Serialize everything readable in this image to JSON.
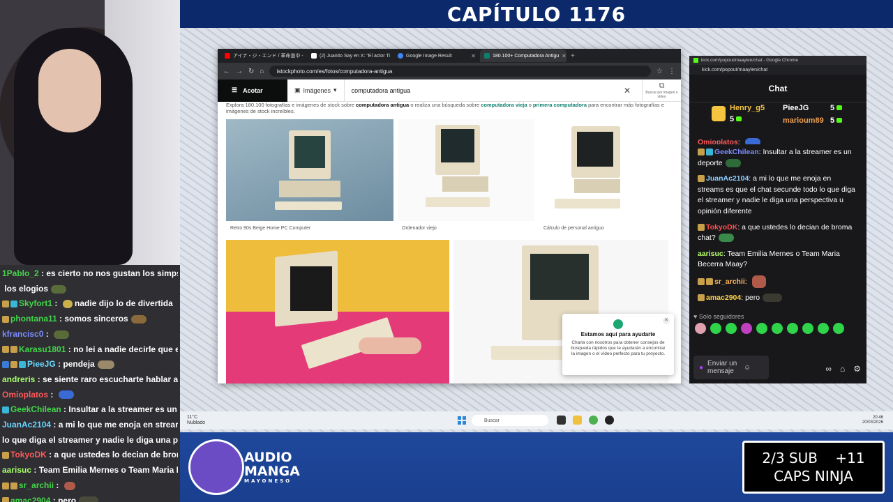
{
  "stream": {
    "chapter_title": "CAPÍTULO 1176",
    "logo_line1": "AUDIO",
    "logo_line2": "MANGA",
    "logo_line3": "MAYONESO",
    "sub_goal": "2/3 SUB    +11",
    "sub_name": "CAPS NINJA"
  },
  "left_chat": [
    {
      "user": "1Pablo_2",
      "text": "es cierto no nos gustan los simps, p",
      "color": "green"
    },
    {
      "user": "",
      "text": "los elogios",
      "color": "white"
    },
    {
      "user": "Skyfort1",
      "text": "nadie dijo lo de divertida",
      "color": "green"
    },
    {
      "user": "phontana11",
      "text": "somos sinceros",
      "color": "green"
    },
    {
      "user": "kfrancisc0",
      "text": "",
      "color": "blue"
    },
    {
      "user": "Karasu1801",
      "text": "no lei a nadie decirle que era",
      "color": "green"
    },
    {
      "user": "PieeJG",
      "text": "pendeja",
      "color": "white"
    },
    {
      "user": "andreris",
      "text": "se siente raro escucharte hablar arge",
      "color": "lime"
    },
    {
      "user": "Omioplatos",
      "text": "",
      "color": "red"
    },
    {
      "user": "GeekChilean",
      "text": "Insultar a la streamer es un de",
      "color": "green"
    },
    {
      "user": "JuanAc2104",
      "text": "a mi lo que me enoja en strear",
      "color": "cyan"
    },
    {
      "user": "",
      "text": "lo que diga el streamer y nadie le diga una persp",
      "color": "white"
    },
    {
      "user": "TokyoDK",
      "text": "a que ustedes lo decian de broma",
      "color": "red"
    },
    {
      "user": "aarisuc",
      "text": "Team Emilia Mernes o Team Maria Be",
      "color": "lime"
    },
    {
      "user": "sr_archii",
      "text": "",
      "color": "green"
    },
    {
      "user": "amac2904",
      "text": "pero",
      "color": "green"
    }
  ],
  "browser": {
    "tabs": [
      {
        "label": "アイナ・ジ・エンド / 革命道中 -",
        "color": "#ff0000"
      },
      {
        "label": "(2) Juanito Say en X: \"El actor Ti",
        "color": "#ffffff"
      },
      {
        "label": "Google Image Result",
        "color": "#4285f4"
      },
      {
        "label": "180.100+ Computadora Antigu",
        "color": "#0d7f6e"
      }
    ],
    "url": "istockphoto.com/es/fotos/computadora-antigua",
    "refine_label": "Acotar",
    "image_type": "Imágenes",
    "search_query": "computadora antigua",
    "visual_search_label": "Buscar por imagen o vídeo",
    "description_start": "Explora 180.100 fotografías e imágenes de stock sobre",
    "description_bold": "computadora antigua",
    "description_mid": "o realiza una búsqueda sobre",
    "description_link1": "computadora vieja",
    "description_or": "o",
    "description_link2": "primera computadora",
    "description_end": "para encontrar más fotografías e imágenes de stock increíbles.",
    "captions": [
      "Retro 90s Beige Home PC Computer",
      "Ordenador viejo",
      "Cálculo de personal antiguo"
    ],
    "help_title": "Estamos aquí para ayudarte",
    "help_text": "Charla con nosotros para obtener consejos de búsqueda rápidos que te ayudarán a encontrar la imagen o el vídeo perfecto para tu proyecto."
  },
  "kick": {
    "window_title": "kick.com/popout/maaylen/chat - Google Chrome",
    "url": "kick.com/popout/maaylen/chat",
    "chat_title": "Chat",
    "leaders": [
      {
        "name": "Henry_g5",
        "count": "5"
      },
      {
        "name": "PieeJG",
        "count": "5"
      },
      {
        "name": "marioum89",
        "count": "5"
      }
    ],
    "messages": [
      {
        "user": "Omioplatos",
        "text": "",
        "color": "#ff5a5a"
      },
      {
        "user": "GeekChilean",
        "text": "Insultar a la streamer es un deporte",
        "color": "#7b8cff"
      },
      {
        "user": "JuanAc2104",
        "text": "a mi lo que me enoja en streams es que el chat secunde todo lo que diga el streamer y nadie le diga una perspectiva u opinión diferente",
        "color": "#8fd0ff"
      },
      {
        "user": "TokyoDK",
        "text": "a que ustedes lo decian de broma chat?",
        "color": "#ff4f4f"
      },
      {
        "user": "aarisuc",
        "text": "Team Emilia Mernes o Team Maria Becerra Maay?",
        "color": "#b7ff6a"
      },
      {
        "user": "sr_archii",
        "text": "",
        "color": "#ffb85a"
      },
      {
        "user": "amac2904",
        "text": "pero",
        "color": "#ffd24a"
      }
    ],
    "followers_only": "Solo seguidores",
    "input_placeholder": "Enviar un mensaje"
  },
  "taskbar": {
    "weather_temp": "11°C",
    "weather_desc": "Nublado",
    "search_label": "Buscar",
    "time": "20:46",
    "date": "20/03/2026"
  }
}
